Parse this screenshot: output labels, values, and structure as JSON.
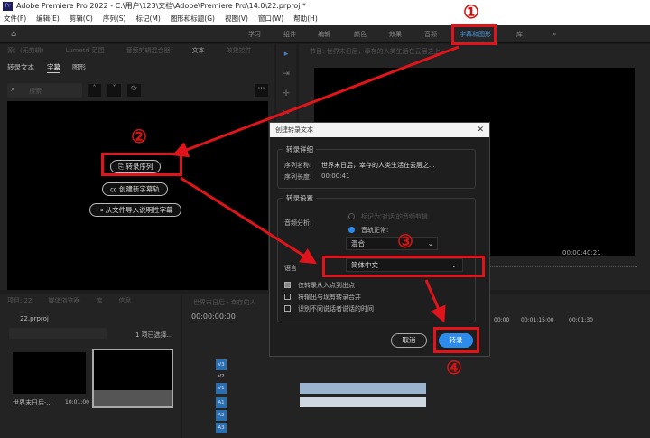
{
  "app": {
    "title": "Adobe Premiere Pro 2022 - C:\\用户\\123\\文档\\Adobe\\Premiere Pro\\14.0\\22.prproj *",
    "logo": "Pr"
  },
  "menu": [
    "文件(F)",
    "编辑(E)",
    "剪辑(C)",
    "序列(S)",
    "标记(M)",
    "图形和标题(G)",
    "视图(V)",
    "窗口(W)",
    "帮助(H)"
  ],
  "workspaces": [
    "学习",
    "组件",
    "编辑",
    "颜色",
    "效果",
    "音频",
    "字幕和图形",
    "库",
    "»"
  ],
  "left_panel": {
    "tabs": [
      "源：(无剪辑)",
      "Lumetri 范围",
      "音频剪辑混合器",
      "文本",
      "效果控件"
    ],
    "subtabs": [
      "转录文本",
      "字幕",
      "图形"
    ],
    "active_subtab": "字幕",
    "search_placeholder": "搜索",
    "buttons": [
      "转录序列",
      "创建新字幕轨",
      "从文件导入说明性字幕"
    ]
  },
  "program": {
    "tab": "节目: 世界末日后，奉存的人类生活在云层之上",
    "timecode": "00:00:40:21"
  },
  "project": {
    "tabs": [
      "项目: 22",
      "媒体浏览器",
      "库",
      "信息"
    ],
    "file": "22.prproj",
    "selected": "1 项已选择...",
    "clip_name": "世界末日后·...",
    "clip_duration": "10:01:00"
  },
  "timeline": {
    "tab": "世界末日后 · 幸存的人",
    "timecode": "00:00:00:00",
    "ruler": [
      "00:00",
      "00:01:15:00",
      "00:01:30"
    ],
    "tracks": [
      "V3",
      "V2",
      "V1",
      "A1",
      "A2",
      "A3"
    ]
  },
  "dialog": {
    "title": "创建转录文本",
    "details_label": "转录详细",
    "seq_name_label": "序列名称:",
    "seq_name": "世界末日后，幸存的人类生活在云层之...",
    "seq_len_label": "序列长度:",
    "seq_len": "00:00:41",
    "settings_label": "转录设置",
    "audio_label": "音频分析:",
    "radio1": "标记为'对话'的音频剪辑",
    "radio2": "音轨正常:",
    "mix": "混合",
    "lang_label": "语言",
    "lang": "简体中文",
    "chk1": "仅转录从入点到出点",
    "chk2": "将输出与现有转录合并",
    "chk3": "识别不同说话者说话的时间",
    "cancel": "取消",
    "ok": "转录"
  },
  "annotations": [
    "①",
    "②",
    "③",
    "④"
  ],
  "colors": {
    "red": "#e0141a",
    "accent": "#2d8ceb"
  }
}
